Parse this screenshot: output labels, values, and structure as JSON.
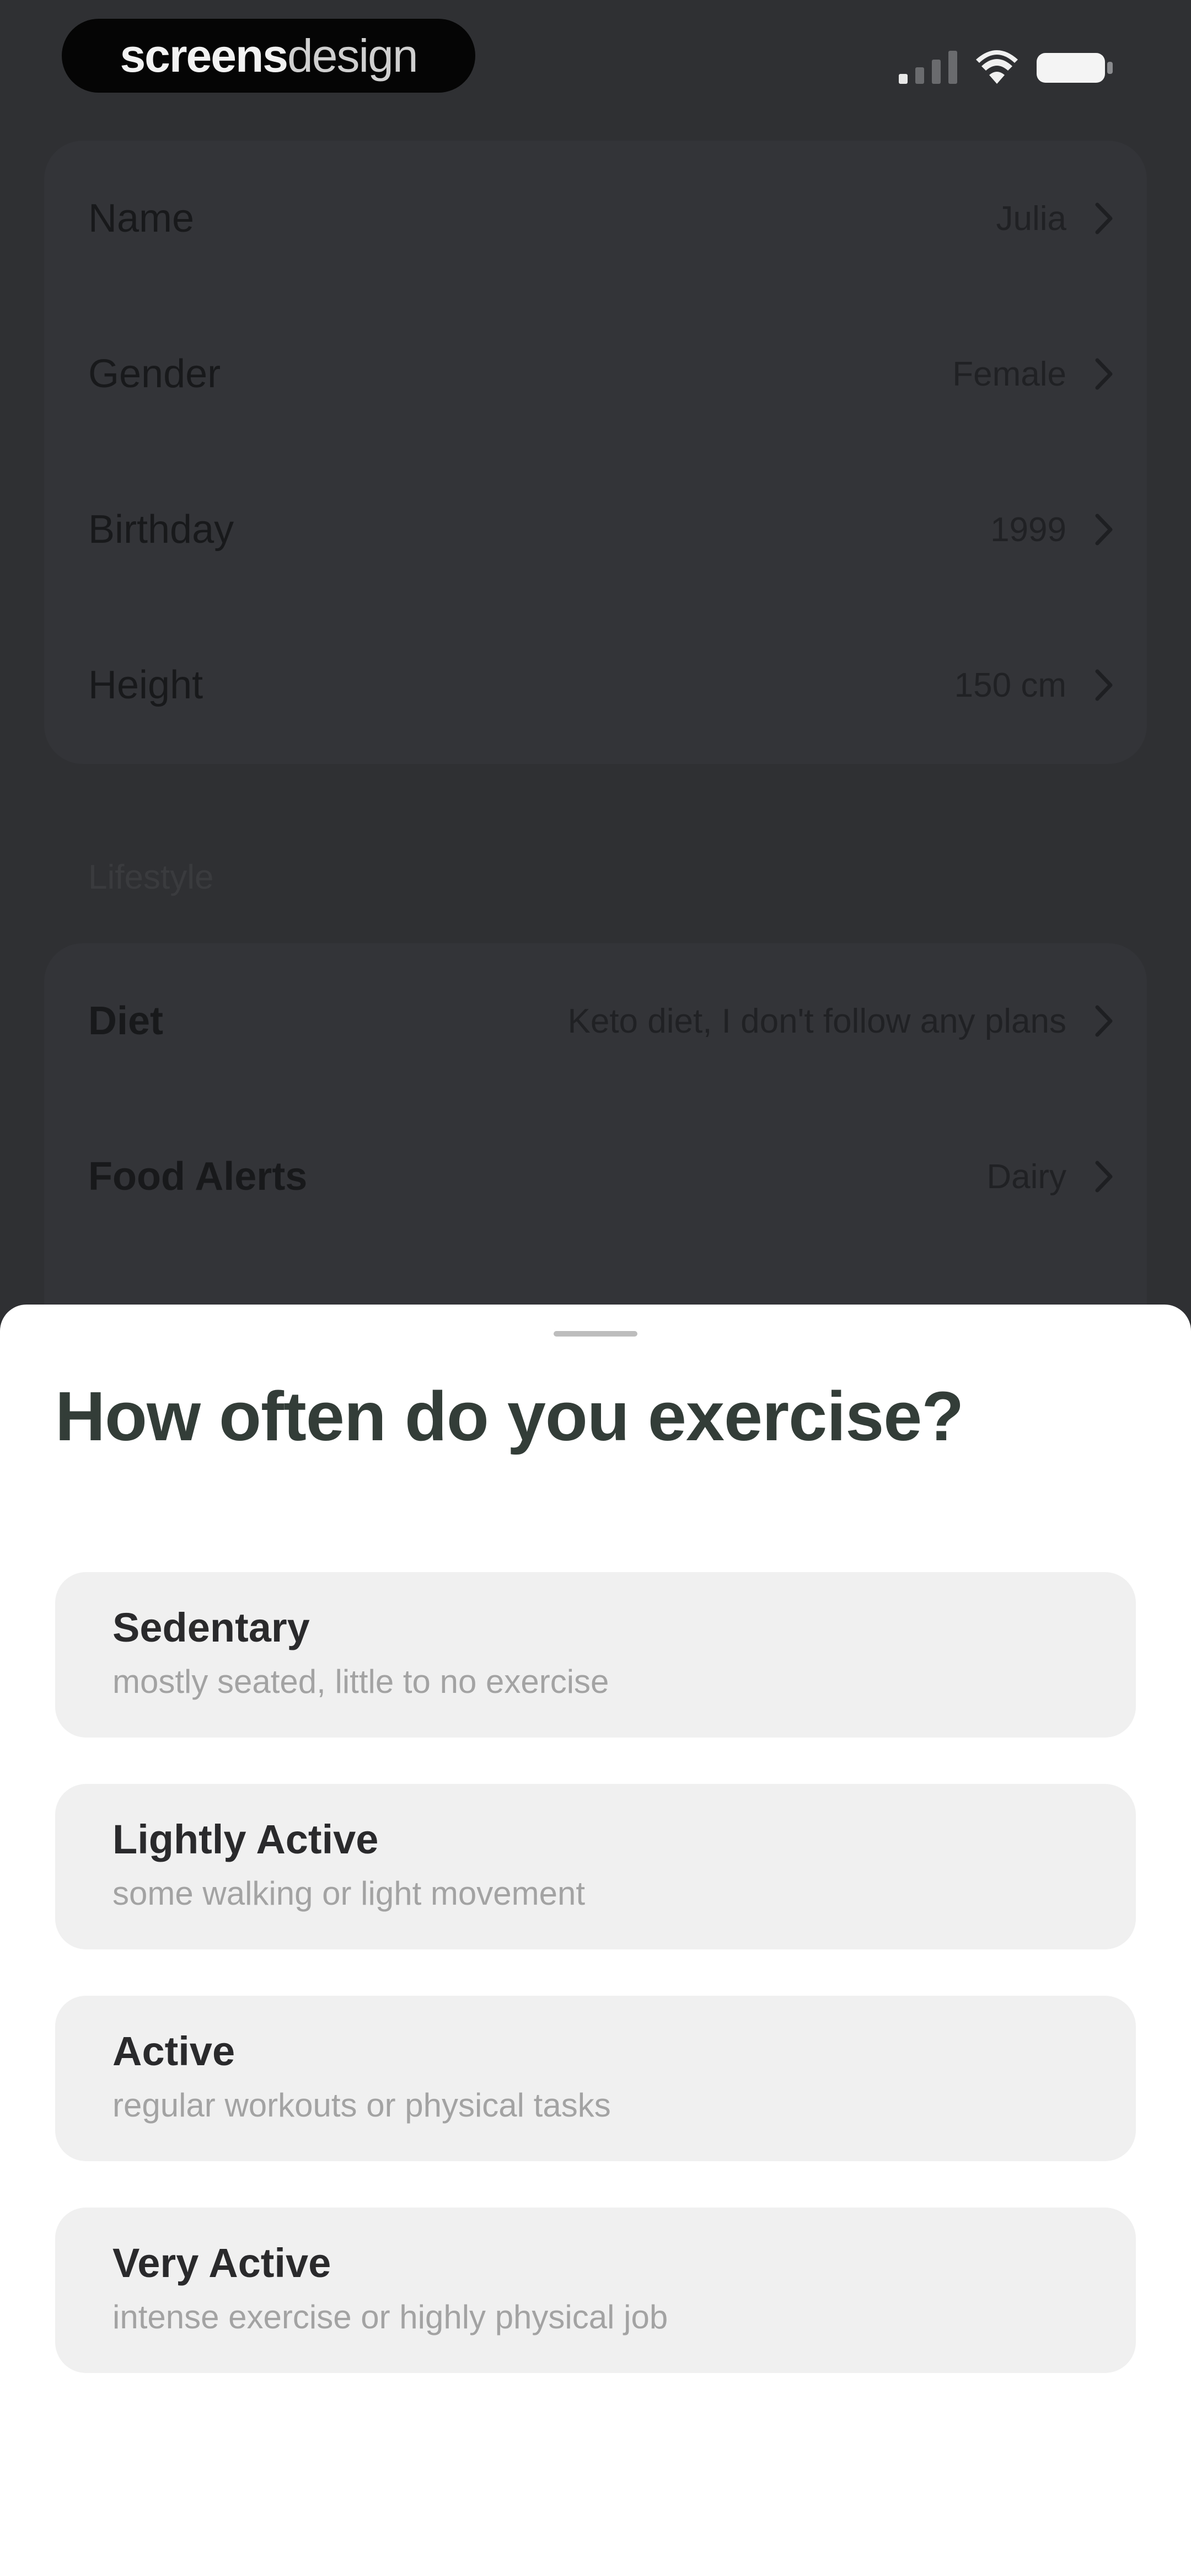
{
  "status_bar": {
    "brand_bold": "screens",
    "brand_light": "design"
  },
  "profile_rows": [
    {
      "label": "Name",
      "value": "Julia"
    },
    {
      "label": "Gender",
      "value": "Female"
    },
    {
      "label": "Birthday",
      "value": "1999"
    },
    {
      "label": "Height",
      "value": "150 cm"
    }
  ],
  "lifestyle_section": {
    "header": "Lifestyle",
    "rows": [
      {
        "label": "Diet",
        "value": "Keto diet, I don't follow any plans"
      },
      {
        "label": "Food Alerts",
        "value": "Dairy"
      }
    ]
  },
  "sheet": {
    "title": "How often do you exercise?",
    "options": [
      {
        "title": "Sedentary",
        "subtitle": "mostly seated, little to no exercise"
      },
      {
        "title": "Lightly Active",
        "subtitle": "some walking or light movement"
      },
      {
        "title": "Active",
        "subtitle": "regular workouts or physical tasks"
      },
      {
        "title": "Very Active",
        "subtitle": "intense exercise or highly physical job"
      }
    ]
  },
  "colors": {
    "overlay_background": "#2f3033",
    "sheet_background": "#ffffff",
    "option_background": "#f0f0f0",
    "title_color": "#333d38"
  }
}
